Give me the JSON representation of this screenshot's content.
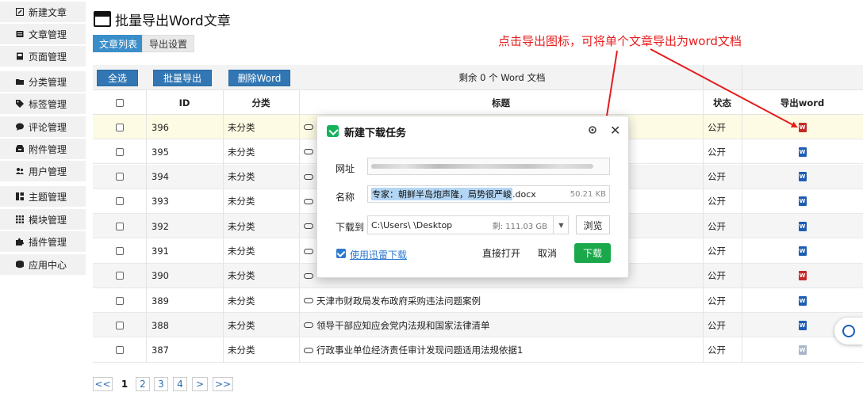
{
  "sidebar": {
    "items": [
      {
        "label": "新建文章",
        "icon": "edit-icon"
      },
      {
        "label": "文章管理",
        "icon": "document-icon"
      },
      {
        "label": "页面管理",
        "icon": "page-icon"
      },
      {
        "label": "分类管理",
        "icon": "folder-icon"
      },
      {
        "label": "标签管理",
        "icon": "tag-icon"
      },
      {
        "label": "评论管理",
        "icon": "comment-icon"
      },
      {
        "label": "附件管理",
        "icon": "attachment-icon"
      },
      {
        "label": "用户管理",
        "icon": "users-icon"
      },
      {
        "label": "主题管理",
        "icon": "theme-icon"
      },
      {
        "label": "模块管理",
        "icon": "grid-icon"
      },
      {
        "label": "插件管理",
        "icon": "puzzle-icon"
      },
      {
        "label": "应用中心",
        "icon": "app-center-icon"
      }
    ]
  },
  "page": {
    "title": "批量导出Word文章",
    "tabs": [
      {
        "label": "文章列表",
        "active": true
      },
      {
        "label": "导出设置",
        "active": false
      }
    ]
  },
  "toolbar": {
    "select_all": "全选",
    "batch_export": "批量导出",
    "delete_word": "删除Word",
    "remaining": "剩余 0 个 Word 文档"
  },
  "table": {
    "headers": {
      "id": "ID",
      "category": "分类",
      "title": "标题",
      "status": "状态",
      "export": "导出word"
    },
    "rows": [
      {
        "id": "396",
        "category": "未分类",
        "title": "",
        "status": "公开",
        "icon": "red"
      },
      {
        "id": "395",
        "category": "未分类",
        "title": "",
        "status": "公开",
        "icon": "blue"
      },
      {
        "id": "394",
        "category": "未分类",
        "title": "",
        "status": "公开",
        "icon": "blue"
      },
      {
        "id": "393",
        "category": "未分类",
        "title": "",
        "status": "公开",
        "icon": "blue"
      },
      {
        "id": "392",
        "category": "未分类",
        "title": "",
        "status": "公开",
        "icon": "blue"
      },
      {
        "id": "391",
        "category": "未分类",
        "title": "",
        "status": "公开",
        "icon": "blue"
      },
      {
        "id": "390",
        "category": "未分类",
        "title": "",
        "status": "公开",
        "icon": "red"
      },
      {
        "id": "389",
        "category": "未分类",
        "title": "天津市财政局发布政府采购违法问题案例",
        "status": "公开",
        "icon": "blue"
      },
      {
        "id": "388",
        "category": "未分类",
        "title": "领导干部应知应会党内法规和国家法律清单",
        "status": "公开",
        "icon": "blue"
      },
      {
        "id": "387",
        "category": "未分类",
        "title": "行政事业单位经济责任审计发现问题适用法规依据1",
        "status": "公开",
        "icon": "gray"
      }
    ]
  },
  "pagination": {
    "first": "<<",
    "pages": [
      "1",
      "2",
      "3",
      "4"
    ],
    "current": "1",
    "next": ">",
    "last": ">>"
  },
  "annotation": {
    "text": "点击导出图标，可将单个文章导出为word文档",
    "color": "#e51d1d"
  },
  "dialog": {
    "title": "新建下载任务",
    "url_label": "网址",
    "name_label": "名称",
    "name_value_selected": "专家：朝鲜半岛炮声隆，局势很严峻",
    "name_value_ext": ".docx",
    "name_size": "50.21 KB",
    "save_label": "下载到",
    "save_path": "C:\\Users\\      \\Desktop",
    "free_space": "剩: 111.03 GB",
    "browse": "浏览",
    "use_thunder": "使用迅雷下载",
    "open_direct": "直接打开",
    "cancel": "取消",
    "download": "下载"
  },
  "colors": {
    "primary": "#3277b4",
    "tab_active": "#3a8ec9",
    "download_green": "#1ba84a",
    "highlight_row": "#fdfbe3",
    "word_blue": "#1e5db3",
    "word_red": "#c62828"
  }
}
